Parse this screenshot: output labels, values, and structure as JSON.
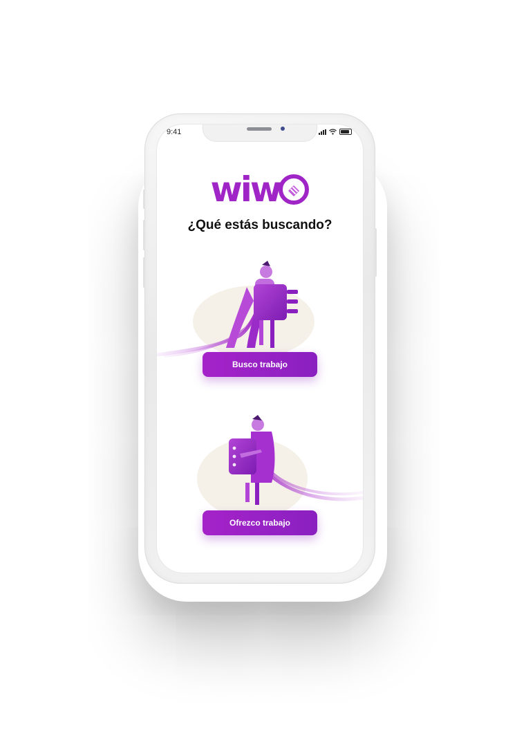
{
  "status_bar": {
    "time": "9:41"
  },
  "app": {
    "logo_text": "wiw",
    "question": "¿Qué estás buscando?",
    "options": [
      {
        "label": "Busco trabajo",
        "illustration": "person-carrying-plug-icon"
      },
      {
        "label": "Ofrezco trabajo",
        "illustration": "person-carrying-socket-icon"
      }
    ]
  },
  "colors": {
    "brand_purple": "#a025c6",
    "button_start": "#a523c9",
    "button_end": "#8a20c0",
    "blob_beige": "#f5f1e8"
  }
}
